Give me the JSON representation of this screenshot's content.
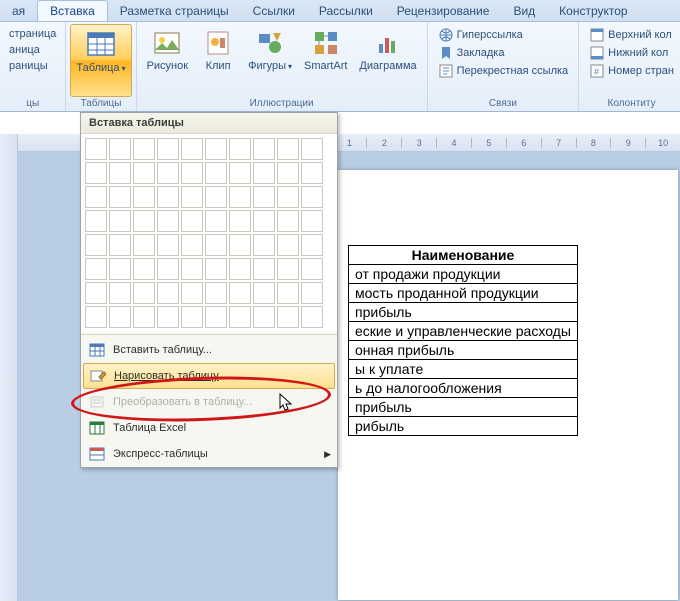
{
  "tabs": [
    "ая",
    "Вставка",
    "Разметка страницы",
    "Ссылки",
    "Рассылки",
    "Рецензирование",
    "Вид",
    "Конструктор"
  ],
  "active_tab": 1,
  "groups": {
    "pages": {
      "label": "цы",
      "items": [
        "страница",
        "аница",
        "раницы"
      ]
    },
    "tables": {
      "label": "Таблицы",
      "btn": "Таблица"
    },
    "illus": {
      "label": "Иллюстрации",
      "items": [
        "Рисунок",
        "Клип",
        "Фигуры",
        "SmartArt",
        "Диаграмма"
      ]
    },
    "links": {
      "label": "Связи",
      "items": [
        "Гиперссылка",
        "Закладка",
        "Перекрестная ссылка"
      ]
    },
    "headfoot": {
      "label": "Колонтиту",
      "items": [
        "Верхний кол",
        "Нижний кол",
        "Номер стран"
      ]
    }
  },
  "dropdown": {
    "title": "Вставка таблицы",
    "items": [
      {
        "label": "Вставить таблицу...",
        "disabled": false
      },
      {
        "label": "Нарисовать таблицу",
        "disabled": false,
        "highlight": true
      },
      {
        "label": "Преобразовать в таблицу...",
        "disabled": true
      },
      {
        "label": "Таблица Excel",
        "disabled": false
      },
      {
        "label": "Экспресс-таблицы",
        "disabled": false,
        "submenu": true
      }
    ]
  },
  "ruler_ticks": [
    "",
    "",
    "",
    "",
    "",
    "",
    "",
    "",
    "",
    "1",
    "2",
    "3",
    "4",
    "5",
    "6",
    "7",
    "8",
    "9",
    "10"
  ],
  "doc": {
    "header": "Наименование",
    "rows": [
      "от продажи продукции",
      "мость проданной  продукции",
      "прибыль",
      "еские и управленческие расходы",
      "онная прибыль",
      "ы к уплате",
      "ь до налогообложения",
      "прибыль",
      "рибыль"
    ]
  }
}
